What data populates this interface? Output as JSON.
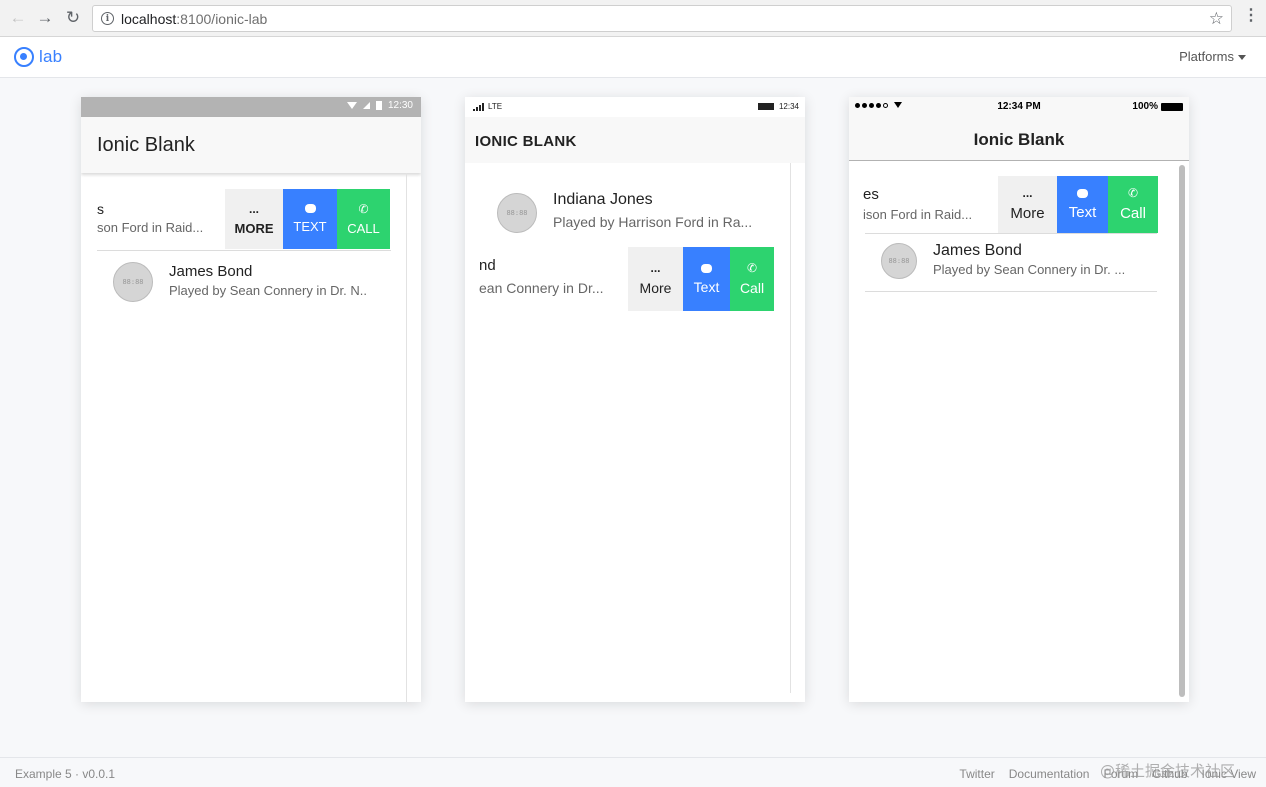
{
  "browser": {
    "url_host": "localhost",
    "url_path": ":8100/ionic-lab"
  },
  "lab": {
    "logo_text": "lab",
    "platforms_label": "Platforms"
  },
  "android": {
    "status_time": "12:30",
    "title": "Ionic Blank",
    "swiped_item": {
      "name": "s",
      "sub": "son Ford in Raid..."
    },
    "item": {
      "name": "James Bond",
      "sub": "Played by Sean Connery in Dr. N..",
      "avatar": "88:88"
    },
    "options": {
      "more_glyph": "...",
      "more": "MORE",
      "text": "TEXT",
      "call": "CALL"
    }
  },
  "windows": {
    "carrier": "LTE",
    "status_time": "12:34",
    "title": "IONIC BLANK",
    "item": {
      "name": "Indiana Jones",
      "sub": "Played by Harrison Ford in Ra...",
      "avatar": "88:88"
    },
    "swiped_item": {
      "name": "nd",
      "sub": "ean Connery in Dr..."
    },
    "options": {
      "more_glyph": "...",
      "more": "More",
      "text": "Text",
      "call": "Call"
    }
  },
  "ios": {
    "status_time": "12:34 PM",
    "battery": "100%",
    "title": "Ionic Blank",
    "swiped_item": {
      "name": "es",
      "sub": "ison Ford in Raid..."
    },
    "item": {
      "name": "James Bond",
      "sub": "Played by Sean Connery in Dr. ...",
      "avatar": "88:88"
    },
    "options": {
      "more_glyph": "...",
      "more": "More",
      "text": "Text",
      "call": "Call"
    }
  },
  "footer": {
    "version": "Example 5 · v0.0.1",
    "links": [
      "Twitter",
      "Documentation",
      "Forum",
      "Github",
      "Ionic View"
    ]
  },
  "watermark": "@稀土掘金技术社区"
}
